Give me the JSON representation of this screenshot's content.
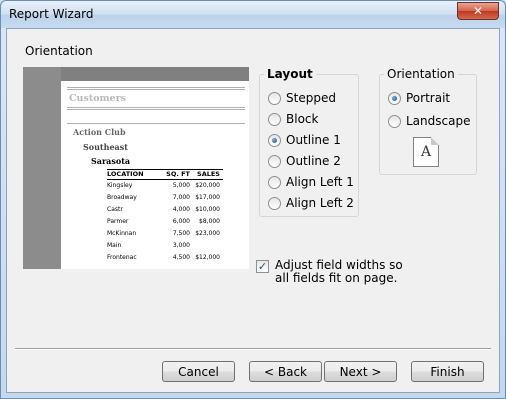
{
  "window": {
    "title": "Report Wizard",
    "close_glyph": "✕"
  },
  "page": {
    "section_title": "Orientation"
  },
  "preview": {
    "report_title": "Customers",
    "group1": "Action Club",
    "group2": "Southeast",
    "group3": "Sarasota",
    "headers": [
      "LOCATION",
      "SQ. FT",
      "SALES"
    ],
    "rows": [
      [
        "Kingsley",
        "5,000",
        "$20,000"
      ],
      [
        "Broadway",
        "7,000",
        "$17,000"
      ],
      [
        "Castr",
        "4,000",
        "$10,000"
      ],
      [
        "Parmer",
        "6,000",
        "$8,000"
      ],
      [
        "McKinnan",
        "7,500",
        "$23,000"
      ],
      [
        "Main",
        "3,000",
        ""
      ],
      [
        "Frontenac",
        "4,500",
        "$12,000"
      ]
    ]
  },
  "layout": {
    "legend": "Layout",
    "options": [
      "Stepped",
      "Block",
      "Outline 1",
      "Outline 2",
      "Align Left 1",
      "Align Left 2"
    ],
    "selected": "Outline 1"
  },
  "orientation": {
    "legend": "Orientation",
    "options": [
      "Portrait",
      "Landscape"
    ],
    "selected": "Portrait",
    "icon_letter": "A"
  },
  "adjust": {
    "label": "Adjust field widths so all fields fit on page.",
    "checked": true,
    "check_glyph": "✓"
  },
  "buttons": {
    "cancel": "Cancel",
    "back": "< Back",
    "next": "Next >",
    "finish": "Finish"
  }
}
